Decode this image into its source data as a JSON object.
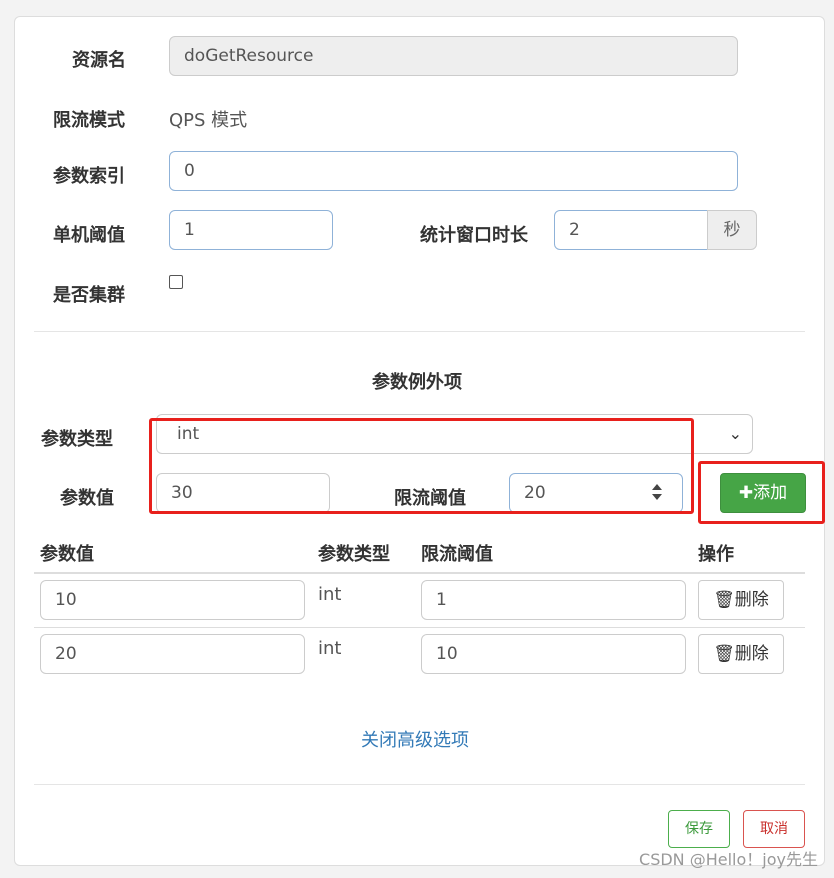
{
  "form": {
    "resource_label": "资源名",
    "resource_value": "doGetResource",
    "mode_label": "限流模式",
    "mode_value": "QPS 模式",
    "param_index_label": "参数索引",
    "param_index_value": "0",
    "threshold_label": "单机阈值",
    "threshold_value": "1",
    "window_label": "统计窗口时长",
    "window_value": "2",
    "window_unit": "秒",
    "cluster_label": "是否集群"
  },
  "exceptions": {
    "section_title": "参数例外项",
    "param_type_label": "参数类型",
    "param_type_value": "int",
    "param_value_label": "参数值",
    "param_value_value": "30",
    "limit_label": "限流阈值",
    "limit_value": "20",
    "add_button": "添加",
    "table": {
      "headers": [
        "参数值",
        "参数类型",
        "限流阈值",
        "操作"
      ],
      "rows": [
        {
          "value": "10",
          "type": "int",
          "limit": "1",
          "action": "删除"
        },
        {
          "value": "20",
          "type": "int",
          "limit": "10",
          "action": "删除"
        }
      ]
    },
    "close_link": "关闭高级选项"
  },
  "footer": {
    "save": "保存",
    "cancel": "取消"
  },
  "watermark": "CSDN @Hello！joy先生",
  "colors": {
    "highlight": "#e8201c",
    "add_button": "#46a546",
    "link": "#337ab7"
  }
}
